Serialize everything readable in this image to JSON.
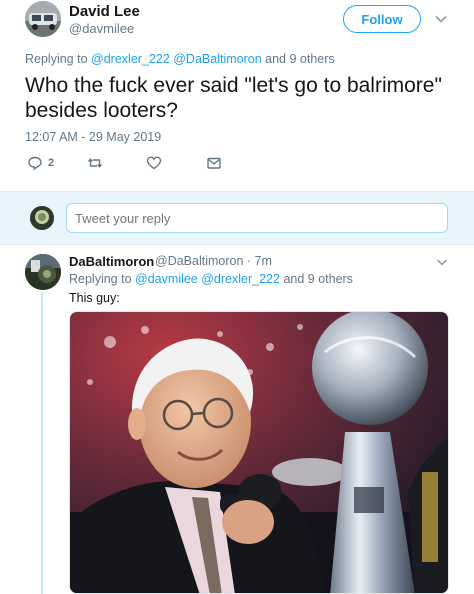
{
  "tweet": {
    "author_name": "David Lee",
    "author_handle": "@davmilee",
    "follow_label": "Follow",
    "reply_prefix": "Replying to",
    "reply_mention_1": "@drexler_222",
    "reply_mention_2": "@DaBaltimoron",
    "reply_suffix": "and 9 others",
    "text": "Who the fuck ever said \"let's go to balrimore\" besides looters?",
    "timestamp": "12:07 AM - 29 May 2019",
    "reply_count": "2",
    "icons": [
      "reply-icon",
      "retweet-icon",
      "like-icon",
      "message-icon"
    ]
  },
  "reply_box": {
    "placeholder": "Tweet your reply"
  },
  "reply_tweet": {
    "author_name": "DaBaltimoron",
    "meta": "@DaBaltimoron · 7m",
    "reply_prefix": "Replying to",
    "reply_mention_1": "@davmilee",
    "reply_mention_2": "@drexler_222",
    "reply_suffix": "and 9 others",
    "text": "This guy:"
  },
  "colors": {
    "accent": "#1da1f2",
    "secondary_text": "#657786",
    "reply_bar_bg": "#e8f5fd"
  }
}
